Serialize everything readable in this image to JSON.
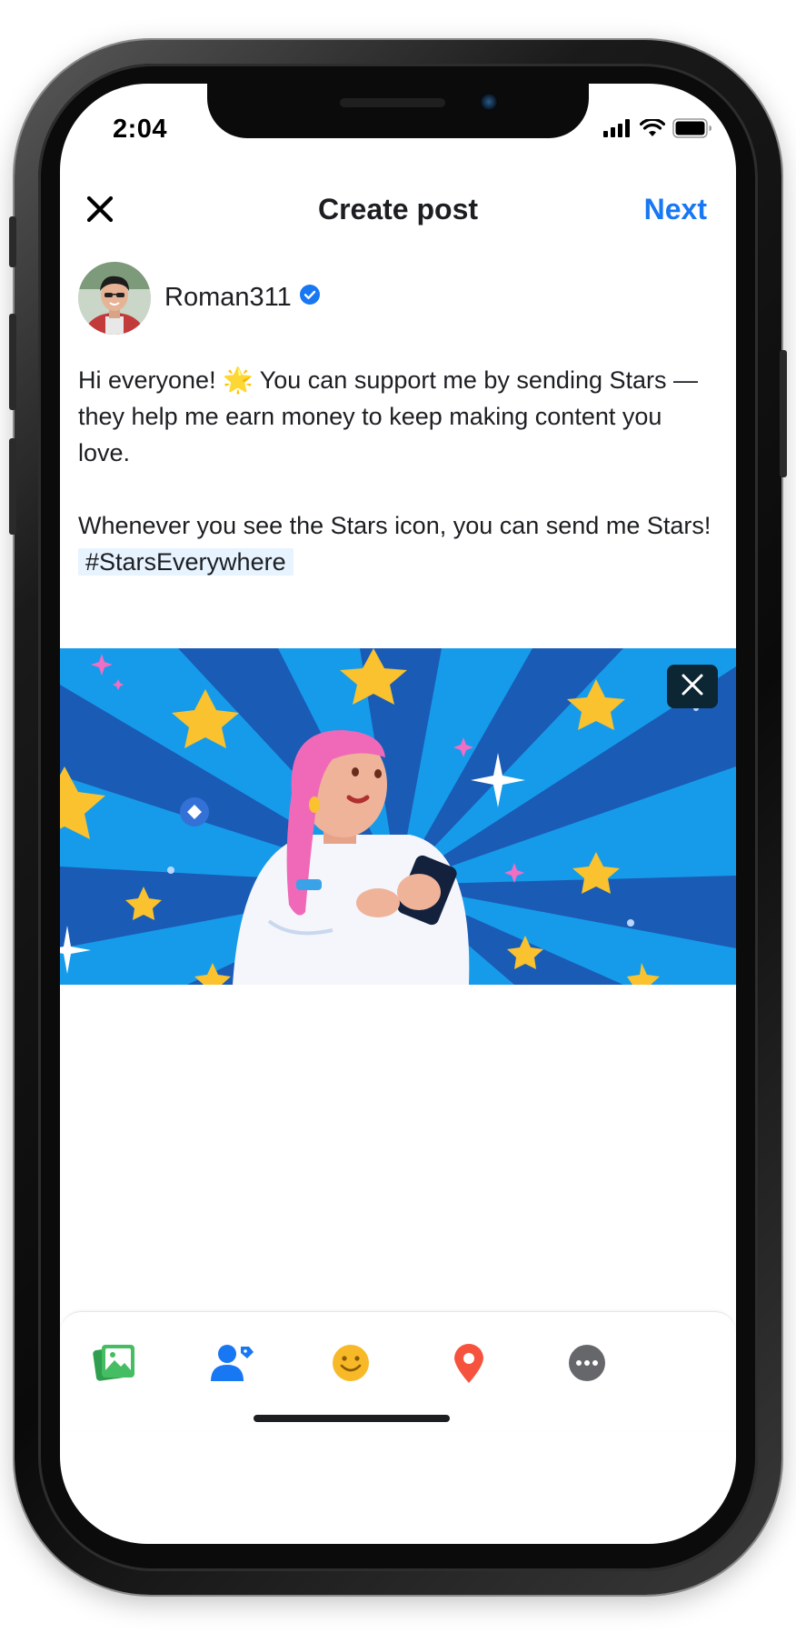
{
  "status_bar": {
    "time": "2:04"
  },
  "header": {
    "title": "Create post",
    "next_label": "Next",
    "close_icon": "close-icon"
  },
  "author": {
    "name": "Roman311",
    "verified_icon": "verified-badge-icon"
  },
  "post": {
    "paragraph1_a": "Hi everyone! ",
    "paragraph1_emoji": "🌟",
    "paragraph1_b": " You can support me by sending Stars —  they help me earn money to keep making content you love.",
    "paragraph2": "Whenever you see the Stars icon, you can send me Stars! ",
    "hashtag": "#StarsEverywhere"
  },
  "image": {
    "close_icon": "close-icon"
  },
  "toolbar": {
    "items": [
      {
        "icon": "photo-icon",
        "color": "#45bd62"
      },
      {
        "icon": "tag-people-icon",
        "color": "#1877f2"
      },
      {
        "icon": "feeling-icon",
        "color": "#f7b928"
      },
      {
        "icon": "location-icon",
        "color": "#f5533d"
      },
      {
        "icon": "more-icon",
        "color": "#65676b"
      }
    ]
  },
  "colors": {
    "accent": "#1877f2",
    "hashtag_bg": "#e7f3ff",
    "text": "#1c1e21"
  }
}
